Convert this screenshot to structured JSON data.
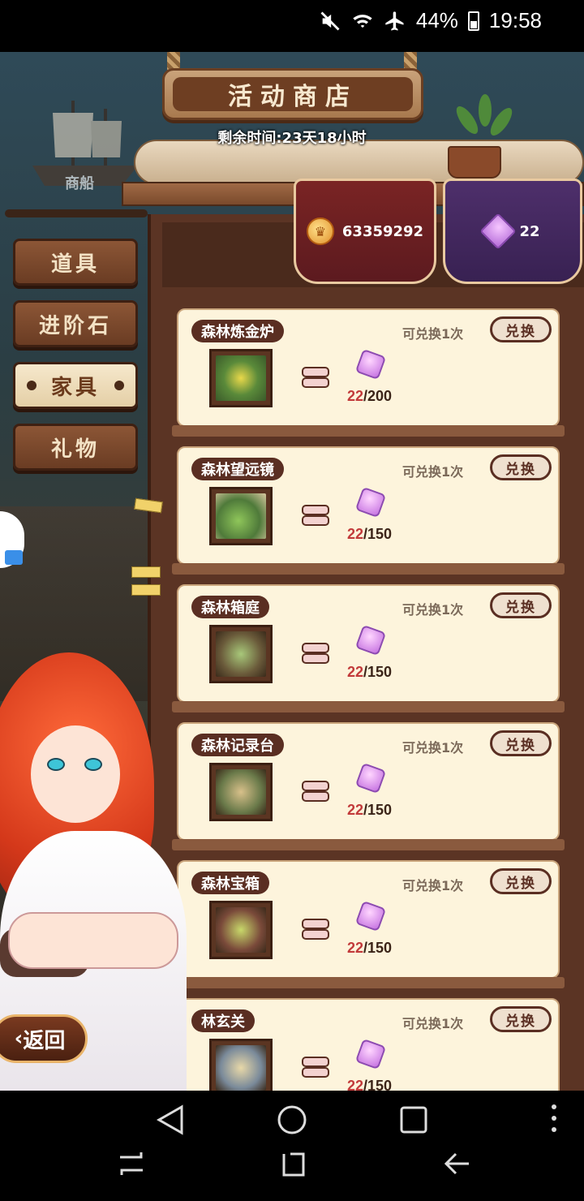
{
  "status_bar": {
    "battery": "44%",
    "time": "19:58"
  },
  "shop": {
    "title": "活动商店",
    "remaining_time": "剩余时间:23天18小时",
    "ship_label": "商船"
  },
  "currency": {
    "gold": "63359292",
    "gems": "22"
  },
  "tabs": [
    {
      "label": "道具",
      "active": false
    },
    {
      "label": "进阶石",
      "active": false
    },
    {
      "label": "家具",
      "active": true
    },
    {
      "label": "礼物",
      "active": false
    }
  ],
  "items": [
    {
      "name": "森林炼金炉",
      "limit": "可兑换1次",
      "button": "兑换",
      "have": "22",
      "cost": "/200"
    },
    {
      "name": "森林望远镜",
      "limit": "可兑换1次",
      "button": "兑换",
      "have": "22",
      "cost": "/150"
    },
    {
      "name": "森林箱庭",
      "limit": "可兑换1次",
      "button": "兑换",
      "have": "22",
      "cost": "/150"
    },
    {
      "name": "森林记录台",
      "limit": "可兑换1次",
      "button": "兑换",
      "have": "22",
      "cost": "/150"
    },
    {
      "name": "森林宝箱",
      "limit": "可兑换1次",
      "button": "兑换",
      "have": "22",
      "cost": "/150"
    },
    {
      "name": "林玄关",
      "limit": "可兑换1次",
      "button": "兑换",
      "have": "22",
      "cost": "/150"
    }
  ],
  "back_button": "返回",
  "icons": {
    "mute": "mute-icon",
    "wifi": "wifi-icon",
    "airplane": "airplane-icon",
    "battery": "battery-icon",
    "coin": "coin-icon",
    "gem": "gem-icon"
  },
  "colors": {
    "gold_panel": "#6a1f22",
    "gem_panel": "#432861",
    "item_card": "#fdf4dc",
    "name_pill": "#5a2e22",
    "accent_red": "#c23a3a"
  }
}
